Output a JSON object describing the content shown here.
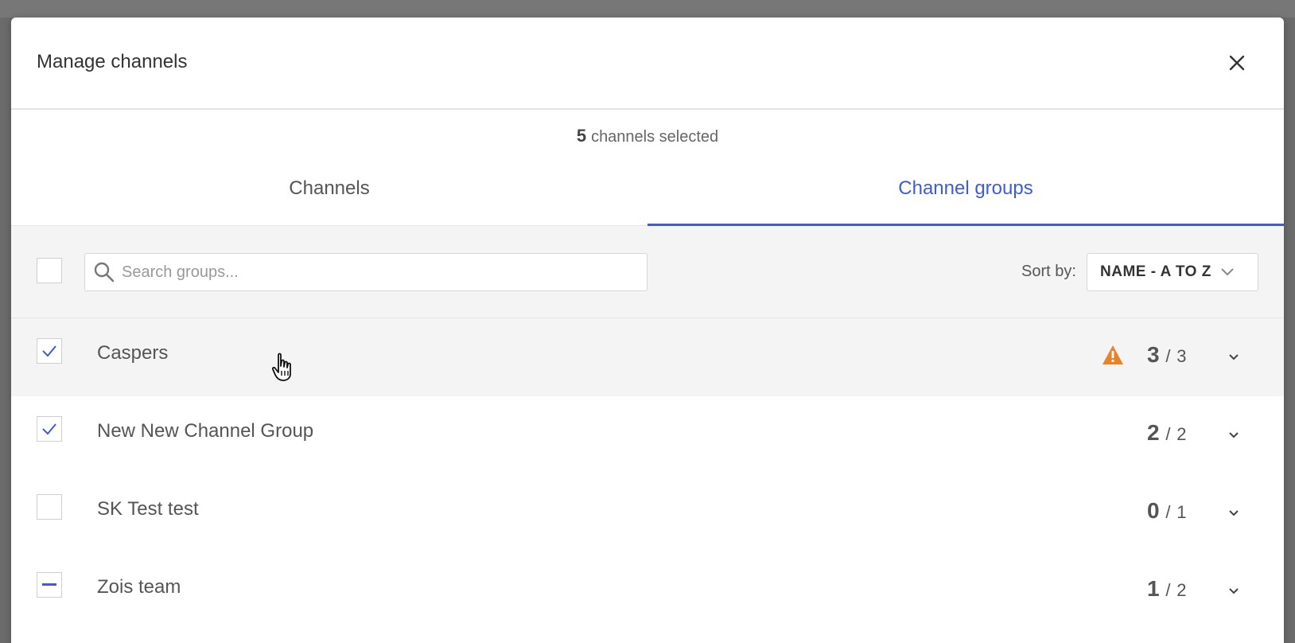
{
  "modal": {
    "title": "Manage channels",
    "selected_count": "5",
    "selected_text": "channels selected"
  },
  "tabs": [
    {
      "label": "Channels",
      "active": false
    },
    {
      "label": "Channel groups",
      "active": true
    }
  ],
  "toolbar": {
    "search_placeholder": "Search groups...",
    "sort_label": "Sort by:",
    "sort_value": "NAME - A TO Z"
  },
  "groups": [
    {
      "name": "Caspers",
      "state": "checked",
      "warning": true,
      "selected": "3",
      "sep": "/",
      "total": "3"
    },
    {
      "name": "New New Channel Group",
      "state": "checked",
      "warning": false,
      "selected": "2",
      "sep": "/",
      "total": "2"
    },
    {
      "name": "SK Test test",
      "state": "unchecked",
      "warning": false,
      "selected": "0",
      "sep": "/",
      "total": "1"
    },
    {
      "name": "Zois team",
      "state": "indeterminate",
      "warning": false,
      "selected": "1",
      "sep": "/",
      "total": "2"
    }
  ],
  "colors": {
    "accent": "#3f5bd6",
    "warning": "#e8832a"
  },
  "icons": {
    "close": "close-icon",
    "search": "search-icon",
    "chevron": "chevron-down-icon",
    "warning": "warning-icon",
    "cursor": "hand-pointer-icon"
  }
}
